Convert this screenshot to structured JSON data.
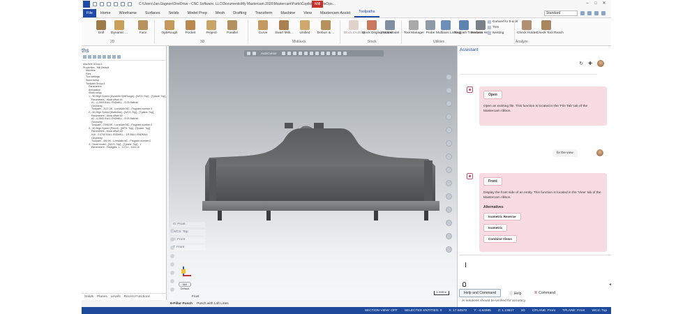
{
  "window": {
    "title": "C:\\Users\\Jan.Gagnon\\OneDrive - CNC Software, LLC\\Documents\\My Mastercam 2026\\Mastercam\\Parts\\Copilot_MultipleOps...",
    "context_tab": "Mill"
  },
  "ribbon": {
    "tabs": [
      "File",
      "Home",
      "Wireframe",
      "Surfaces",
      "Solids",
      "Model Prep",
      "Mesh",
      "Drafting",
      "Transform",
      "Machine",
      "View",
      "Mastercam Assist",
      "Toolpaths"
    ],
    "active_tab": "Toolpaths",
    "standard_select": "Standard",
    "buttons": [
      {
        "label": "Drill",
        "icon": "drill-icon"
      },
      {
        "label": "Dynamic ...",
        "icon": "dynamic-mill-icon"
      },
      {
        "label": "Face",
        "icon": "face-icon"
      },
      {
        "label": "OptiRough",
        "icon": "optirough-icon"
      },
      {
        "label": "Pocket",
        "icon": "pocket-icon"
      },
      {
        "label": "Project",
        "icon": "project-icon"
      },
      {
        "label": "Parallel",
        "icon": "parallel-icon"
      },
      {
        "label": "Curve",
        "icon": "curve-icon"
      },
      {
        "label": "Swarf Milli...",
        "icon": "swarf-icon"
      },
      {
        "label": "Unified",
        "icon": "unified-icon"
      },
      {
        "label": "Deburr & ...",
        "icon": "deburr-icon"
      },
      {
        "label": "Block Drafting",
        "icon": "block-drafting-icon"
      },
      {
        "label": "Block Display Model",
        "icon": "block-display-icon"
      },
      {
        "label": "Stock Model",
        "icon": "stock-model-icon"
      },
      {
        "label": "Tool Manager",
        "icon": "tool-manager-icon"
      },
      {
        "label": "Probe",
        "icon": "probe-icon"
      },
      {
        "label": "Multiaxis Linking",
        "icon": "multiaxis-linking-icon"
      },
      {
        "label": "Toolpath Transform",
        "icon": "toolpath-transform-icon"
      },
      {
        "label": "Process Hole",
        "icon": "process-hole-icon"
      },
      {
        "label": "Check Holder",
        "icon": "check-holder-icon"
      },
      {
        "label": "Check Tool Reach",
        "icon": "check-tool-reach-icon"
      }
    ],
    "small_items": [
      "Convert to 5-axis",
      "Trim",
      "Nesting"
    ],
    "groups": [
      "2D",
      "3D",
      "Multiaxis",
      "Stock",
      "Utilities",
      "Analyze"
    ]
  },
  "toolpaths_panel": {
    "title": "ths",
    "tree": [
      "Machine Group-1",
      "Properties - Mill Default",
      "Machine",
      "Files",
      "Tool settings",
      "Stock setup",
      "Toolpath Group-1",
      "Parameters",
      "Annotation",
      "Stock setup",
      "1 - 3D High Speed (Dynamic OptiRough) - [WCS: Top] - [Tplane: Top]",
      "Parameters - block offset #1",
      "#1 - 0.2500 BALL ENDMILL - 0.25 Ballmill",
      "Geometry",
      "Toolpath - 2137.3K - Lonsdale.NC - Program number 0",
      "2 - 3D High Speed (Waterline) - [WCS: Top] - [Tplane: Top]",
      "Parameters - block offset #2",
      "#2 - 0.2500 BALL ENDMILL - 0.25 Ballmill",
      "Geometry",
      "Toolpath - 2396.9K - Lonsdale.NC - Program number 0",
      "3 - 3D High Speed (Pencil) - [WCS: Top] - [Tplane: Top]",
      "Parameters - block offset #3",
      "#16 - 0.0790 BALL ENDMILL - 1/8 BALL ENDMILL",
      "Geometry",
      "Toolpath - 490.9K - Lonsdale.NC - Program number 0",
      "4 - Stock model - [WCS: Top] - [Tplane: Top] - 1",
      "Parameters - Triangles: 1 - 12711 - 1116.1K"
    ],
    "tabs": [
      "Solids",
      "Planes",
      "Levels",
      "Recent Functions"
    ]
  },
  "viewport": {
    "toolbar_label": "AutoCursor",
    "info": [
      "G: Front",
      "WCS: Top",
      "C: Front",
      "T: Front"
    ],
    "chip": "Mill Default",
    "view_label": "Front",
    "scale": "1.0095 in"
  },
  "sheet_tabs": [
    "6-Pillar Punch",
    "Punch with Loft Lines"
  ],
  "statusbar": [
    "SECTION VIEW: OFF",
    "SELECTED ENTITIES: 0",
    "X: 17.50570",
    "Y: -4.64985",
    "Z: 1.19847",
    "2D",
    "CPLANE: Front",
    "TPLANE: Front",
    "WCS: Top"
  ],
  "assistant": {
    "title": "Assistant",
    "messages": [
      {
        "role": "bot",
        "command": "Open",
        "text": "Open an existing file. This function is located in the 'File Tab' tab of the Mastercam ribbon."
      },
      {
        "role": "user",
        "text": "fix the view"
      },
      {
        "role": "bot",
        "command": "Front",
        "text": "Display the front side of an entity. This function is located in the 'View' tab of the Mastercam ribbon.",
        "alternatives_title": "Alternatives",
        "alternatives": [
          "Isometric Reverse",
          "Isometric",
          "Combine Views"
        ]
      }
    ],
    "footer_tabs": [
      "Help and Command",
      "Help",
      "Command"
    ],
    "disclaimer": "AI solutions should be verified for accuracy."
  }
}
